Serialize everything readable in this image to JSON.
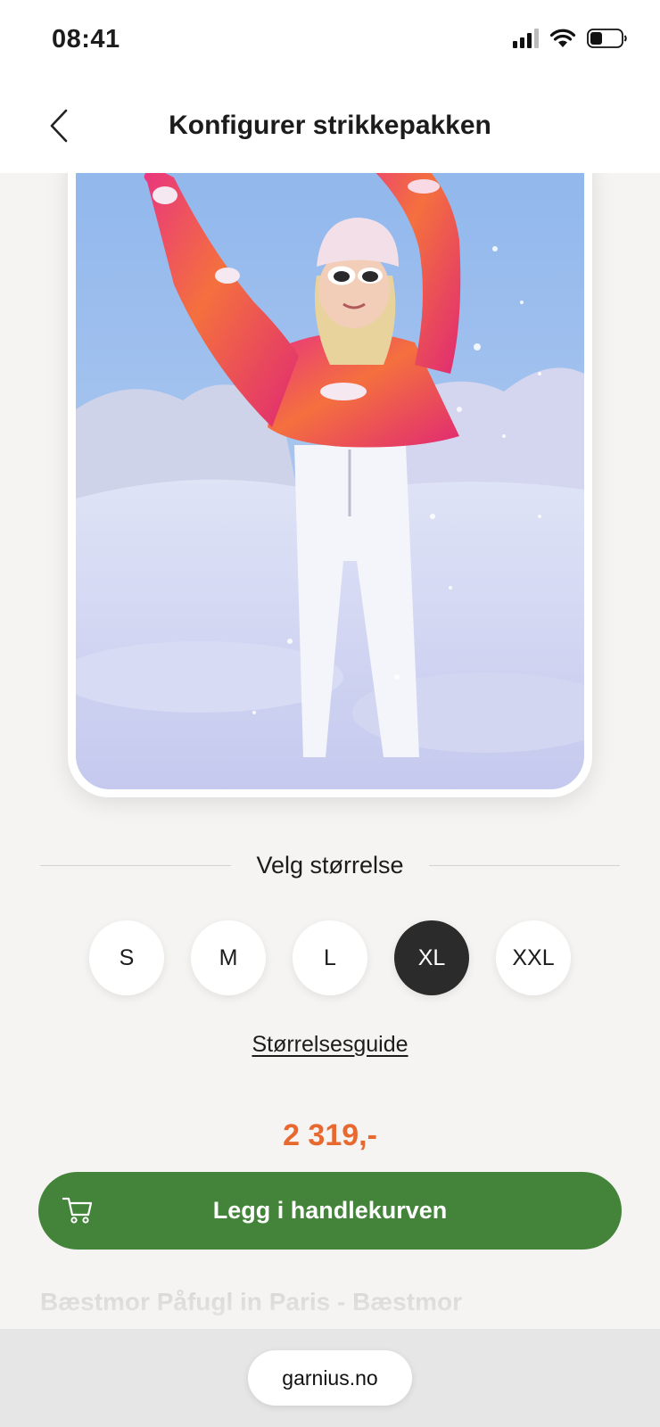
{
  "status_bar": {
    "time": "08:41",
    "icons": [
      "signal-icon",
      "wifi-icon",
      "battery-icon"
    ]
  },
  "header": {
    "title": "Konfigurer strikkepakken",
    "back_icon": "chevron-left-icon"
  },
  "product": {
    "image": "photo-woman-in-pink-orange-sweater-in-snow",
    "size_heading": "Velg størrelse",
    "sizes": [
      {
        "label": "S",
        "selected": false
      },
      {
        "label": "M",
        "selected": false
      },
      {
        "label": "L",
        "selected": false
      },
      {
        "label": "XL",
        "selected": true
      },
      {
        "label": "XXL",
        "selected": false
      }
    ],
    "size_guide_label": "Størrelsesguide",
    "price": "2 319,-",
    "add_to_cart_label": "Legg i handlekurven",
    "cart_icon": "cart-icon",
    "next_product_title": "Bæstmor Påfugl in Paris - Bæstmor"
  },
  "browser": {
    "url": "garnius.no"
  },
  "colors": {
    "accent_price": "#e8692f",
    "cta_green": "#43843a",
    "selected_size": "#2b2b2b",
    "background": "#f5f4f2"
  }
}
